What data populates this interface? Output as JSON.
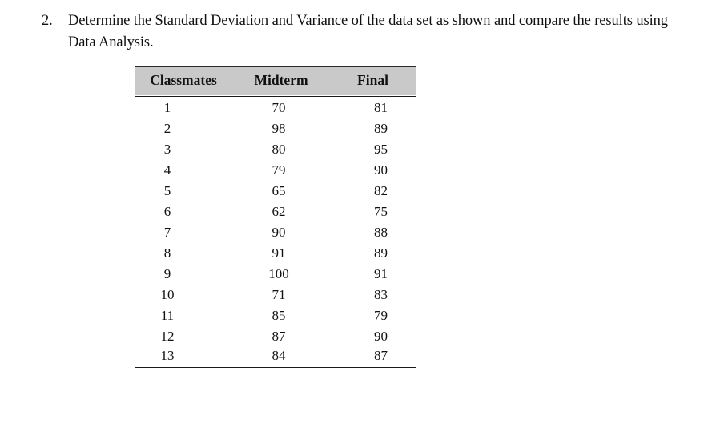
{
  "question": {
    "number": "2.",
    "text": "Determine the Standard Deviation and Variance of the data set as shown and compare the results using Data Analysis."
  },
  "table": {
    "headers": [
      "Classmates",
      "Midterm",
      "Final"
    ],
    "rows": [
      [
        "1",
        "70",
        "81"
      ],
      [
        "2",
        "98",
        "89"
      ],
      [
        "3",
        "80",
        "95"
      ],
      [
        "4",
        "79",
        "90"
      ],
      [
        "5",
        "65",
        "82"
      ],
      [
        "6",
        "62",
        "75"
      ],
      [
        "7",
        "90",
        "88"
      ],
      [
        "8",
        "91",
        "89"
      ],
      [
        "9",
        "100",
        "91"
      ],
      [
        "10",
        "71",
        "83"
      ],
      [
        "11",
        "85",
        "79"
      ],
      [
        "12",
        "87",
        "90"
      ],
      [
        "13",
        "84",
        "87"
      ]
    ],
    "header_background": "#c9c9c9"
  }
}
